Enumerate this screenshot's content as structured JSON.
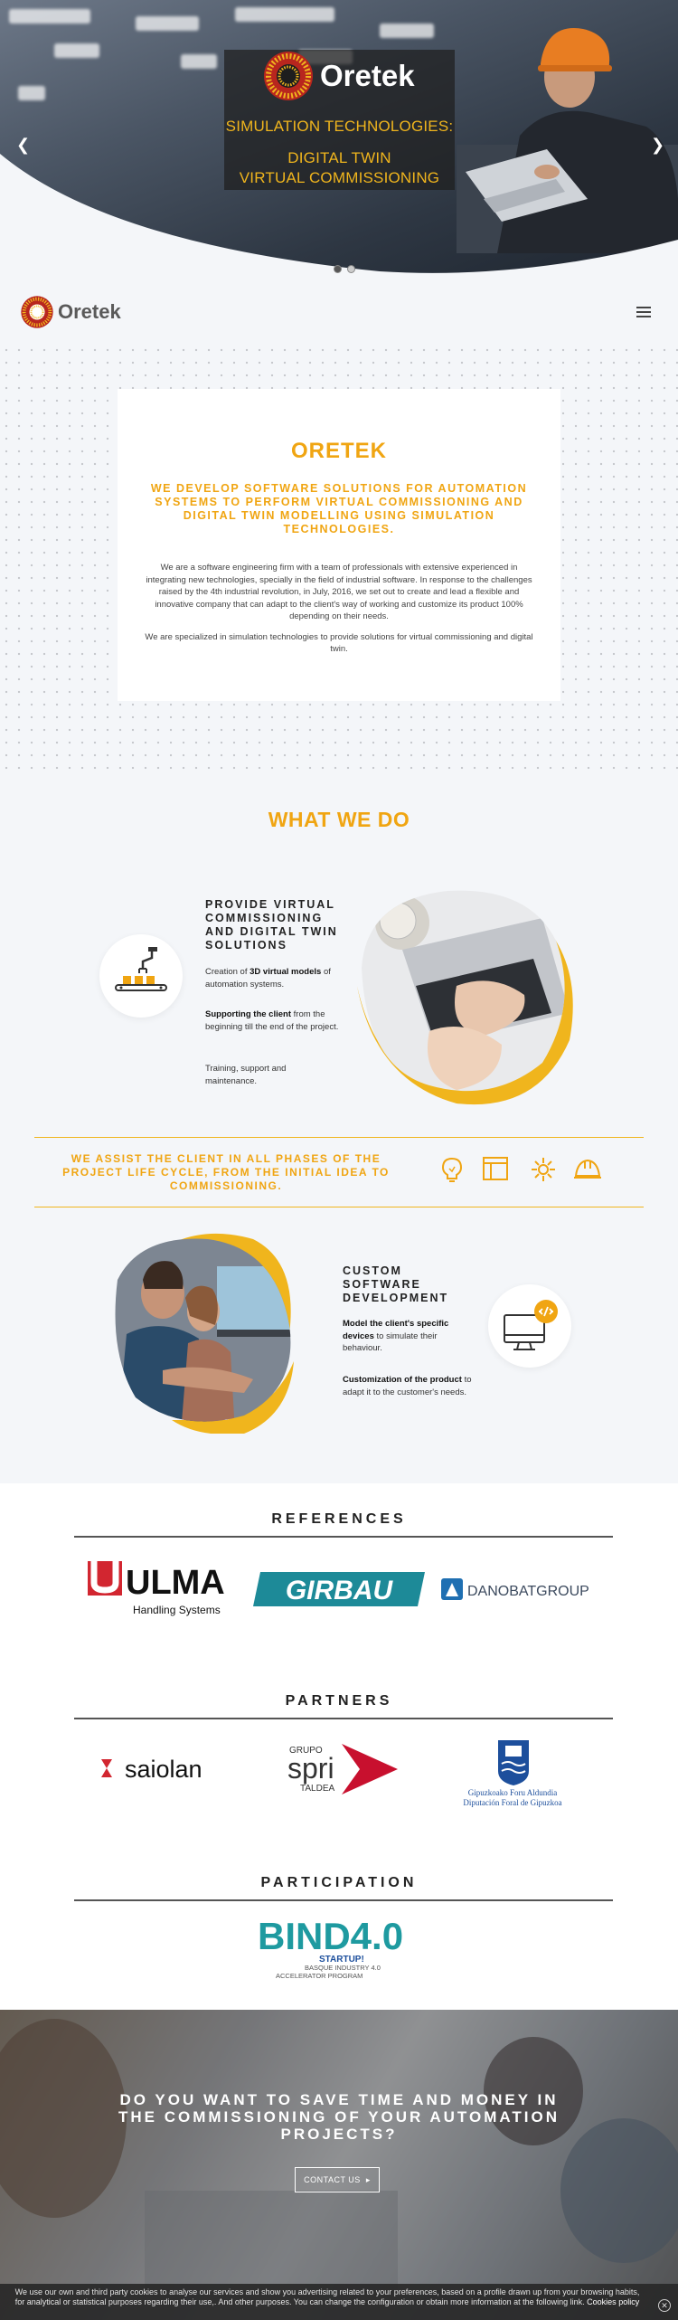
{
  "hero": {
    "logo_text": "Oretek",
    "line1": "SIMULATION TECHNOLOGIES:",
    "line2": "DIGITAL TWIN",
    "line3": "VIRTUAL COMMISSIONING",
    "prev_icon": "chevron-left-icon",
    "next_icon": "chevron-right-icon",
    "slides": 2,
    "active_slide": 1
  },
  "nav": {
    "logo_text": "Oretek",
    "menu_icon": "hamburger-icon"
  },
  "intro": {
    "title": "ORETEK",
    "subtitle": "WE DEVELOP SOFTWARE SOLUTIONS FOR AUTOMATION SYSTEMS TO PERFORM VIRTUAL COMMISSIONING AND DIGITAL TWIN MODELLING USING SIMULATION TECHNOLOGIES.",
    "p1": "We are a software engineering firm with a team of professionals with extensive experienced in integrating new technologies, specially in the field of industrial software. In response to the challenges raised by the 4th industrial revolution, in July, 2016, we set out to create and lead a flexible and innovative company that can adapt to the client's way of working and customize its product 100% depending on their needs.",
    "p2": "We are specialized in simulation technologies to provide solutions for virtual commissioning and digital twin."
  },
  "what_we_do": {
    "title": "WHAT WE DO",
    "feature1": {
      "heading": "PROVIDE VIRTUAL COMMISSIONING AND DIGITAL TWIN SOLUTIONS",
      "p1_pre": "Creation of ",
      "p1_bold": "3D virtual models",
      "p1_post": " of automation systems.",
      "p2_bold": "Supporting the client",
      "p2_post": " from the beginning till the end of the project.",
      "p3": "Training, support and maintenance.",
      "icon": "robot-arm-conveyor-icon"
    },
    "assist_text": "WE ASSIST THE CLIENT IN ALL PHASES OF THE PROJECT LIFE CYCLE, FROM THE INITIAL IDEA TO COMMISSIONING.",
    "assist_icons": [
      "lightbulb-icon",
      "layout-icon",
      "gear-cluster-icon",
      "hardhat-icon"
    ],
    "feature2": {
      "heading": "CUSTOM SOFTWARE DEVELOPMENT",
      "p1_bold": "Model the client's specific devices",
      "p1_post": " to simulate their behaviour.",
      "p2_bold": "Customization of the product",
      "p2_post": " to adapt it to the customer's needs.",
      "icon": "computer-code-icon"
    }
  },
  "references": {
    "title": "REFERENCES",
    "logos": [
      "ULMA",
      "Handling Systems",
      "GIRBAU",
      "DANOBATGROUP"
    ]
  },
  "partners": {
    "title": "PARTNERS",
    "saiolan": "saiolan",
    "spri_top": "GRUPO",
    "spri_main": "spri",
    "spri_bottom": "TALDEA",
    "gipuzkoa_1": "Gipuzkoako Foru Aldundia",
    "gipuzkoa_2": "Diputación Foral de Gipuzkoa"
  },
  "participation": {
    "title": "PARTICIPATION",
    "bind_main": "BIND4.0",
    "bind_sub1": "STARTUP!",
    "bind_sub2": "BASQUE INDUSTRY 4.0",
    "bind_sub3": "ACCELERATOR PROGRAM"
  },
  "cta": {
    "headline": "DO YOU WANT TO SAVE TIME AND MONEY IN THE COMMISSIONING OF YOUR AUTOMATION PROJECTS?",
    "button": "CONTACT US"
  },
  "cookie": {
    "text": "We use our own and third party cookies to analyse our services and show you advertising related to your preferences, based on a profile drawn up from your browsing habits, for analytical or statistical purposes regarding their use,. And other purposes. You can change the configuration or obtain more information at the following link.",
    "link": "Cookies policy",
    "close_icon": "close-circle-icon"
  },
  "colors": {
    "accent": "#f0a512",
    "teal": "#1d8a98",
    "danobat_blue": "#1f6fb2",
    "spri_red": "#c8102e"
  }
}
